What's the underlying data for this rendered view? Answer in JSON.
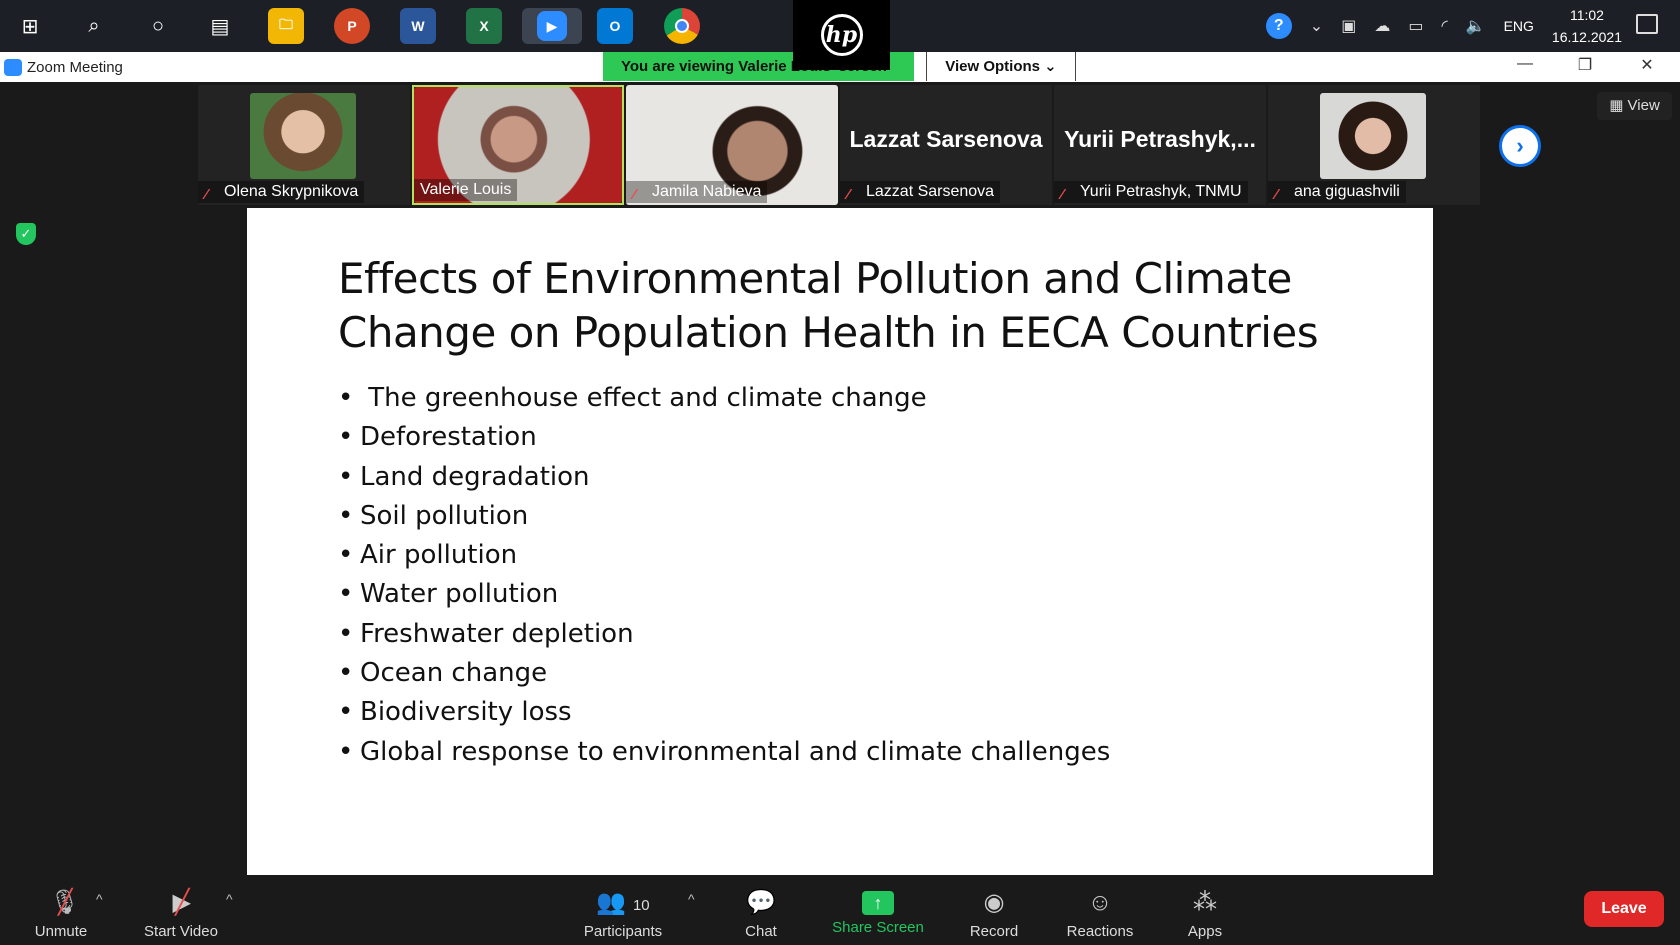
{
  "taskbar": {
    "apps": [
      {
        "icon": "windows-start-icon",
        "glyph": "⊞"
      },
      {
        "icon": "search-icon",
        "glyph": "⌕"
      },
      {
        "icon": "cortana-icon",
        "glyph": "○"
      },
      {
        "icon": "task-view-icon",
        "glyph": "▤"
      },
      {
        "icon": "file-explorer-icon",
        "glyph": "🗀"
      },
      {
        "icon": "powerpoint-icon",
        "glyph": "P"
      },
      {
        "icon": "word-icon",
        "glyph": "W"
      },
      {
        "icon": "excel-icon",
        "glyph": "X"
      },
      {
        "icon": "zoom-icon",
        "glyph": "▶"
      },
      {
        "icon": "outlook-icon",
        "glyph": "O"
      },
      {
        "icon": "chrome-icon",
        "glyph": "◉"
      }
    ],
    "hp_logo": "hp",
    "language": "ENG",
    "time": "11:02",
    "date": "16.12.2021"
  },
  "window": {
    "title": "Zoom Meeting",
    "viewing_banner": "You are viewing Valerie Louis' screen",
    "view_options_label": "View Options ⌄"
  },
  "participants_strip": {
    "tiles": [
      {
        "name": "Olena Skrypnikova",
        "muted": true,
        "video": true,
        "face_color": "#c9a58a"
      },
      {
        "name": "Valerie Louis",
        "muted": false,
        "video": true,
        "active_speaker": true,
        "face_color": "#a07a6a"
      },
      {
        "name": "Jamila Nabieva",
        "muted": true,
        "video": true,
        "face_color": "#8c6a55"
      },
      {
        "name": "Lazzat Sarsenova",
        "muted": true,
        "video": false,
        "display_name": "Lazzat Sarsenova"
      },
      {
        "name": "Yurii Petrashyk, TNMU",
        "muted": true,
        "video": false,
        "display_name": "Yurii  Petrashyk,..."
      },
      {
        "name": "ana giguashvili",
        "muted": true,
        "video": true,
        "face_color": "#b78d78"
      }
    ],
    "view_button_label": "View"
  },
  "slide": {
    "title": "Effects of Environmental Pollution and Climate Change on Population Health in EECA Countries",
    "bullets": [
      " The greenhouse effect and climate change",
      "Deforestation",
      "Land degradation",
      "Soil pollution",
      "Air pollution",
      "Water pollution",
      "Freshwater depletion",
      "Ocean change",
      "Biodiversity loss",
      "Global response to environmental and climate challenges"
    ]
  },
  "toolbar": {
    "unmute": "Unmute",
    "start_video": "Start Video",
    "participants": "Participants",
    "participants_count": "10",
    "chat": "Chat",
    "share_screen": "Share Screen",
    "record": "Record",
    "reactions": "Reactions",
    "apps": "Apps",
    "leave": "Leave"
  },
  "colors": {
    "accent_blue": "#0e71eb",
    "share_green": "#23c55e",
    "leave_red": "#e02828",
    "active_speaker": "#b4e05c"
  }
}
